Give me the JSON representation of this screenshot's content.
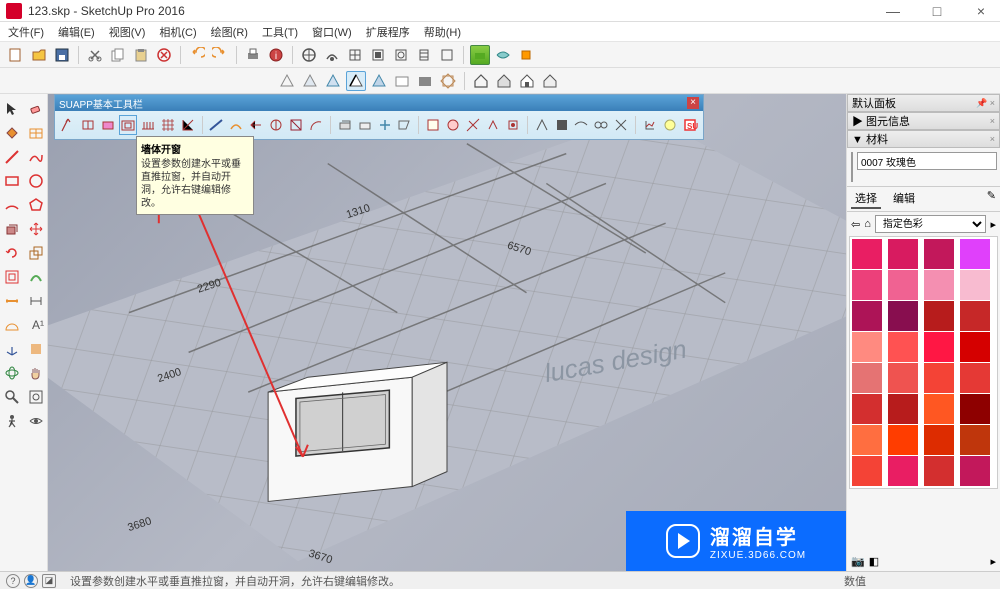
{
  "window": {
    "title": "123.skp - SketchUp Pro 2016",
    "min": "—",
    "max": "□",
    "close": "×"
  },
  "menu": {
    "file": "文件(F)",
    "edit": "编辑(E)",
    "view": "视图(V)",
    "camera": "相机(C)",
    "draw": "绘图(R)",
    "tools": "工具(T)",
    "window": "窗口(W)",
    "extensions": "扩展程序",
    "help": "帮助(H)"
  },
  "suapp": {
    "title": "SUAPP基本工具栏",
    "close": "×"
  },
  "tooltip": {
    "title": "墙体开窗",
    "body": "设置参数创建水平或垂直推拉窗，并自动开洞，允许右键编辑修改。"
  },
  "panel": {
    "default_panel": "默认面板",
    "entity_info": "▶  图元信息",
    "materials": "▼  材料",
    "material_name": "0007 玫瑰色",
    "tabs": {
      "select": "选择",
      "edit": "编辑"
    },
    "dropdown_value": "指定色彩"
  },
  "statusbar": {
    "hint": "设置参数创建水平或垂直推拉窗，并自动开洞，允许右键编辑修改。",
    "value_label": "数值"
  },
  "watermark": {
    "main": "溜溜自学",
    "sub": "ZIXUE.3D66.COM"
  },
  "swatches": [
    "#e91e63",
    "#d81b60",
    "#c2185b",
    "#e040fb",
    "#ec407a",
    "#f06292",
    "#f48fb1",
    "#f8bbd0",
    "#ad1457",
    "#880e4f",
    "#b71c1c",
    "#c62828",
    "#ff8a80",
    "#ff5252",
    "#ff1744",
    "#d50000",
    "#e57373",
    "#ef5350",
    "#f44336",
    "#e53935",
    "#d32f2f",
    "#b71c1c",
    "#ff5722",
    "#8e0000",
    "#ff6e40",
    "#ff3d00",
    "#dd2c00",
    "#bf360c",
    "#f44336",
    "#e91e63",
    "#d32f2f",
    "#c2185b"
  ],
  "viewport_labels": {
    "d1": "3680",
    "d2": "2400",
    "d3": "2290",
    "d4": "1310",
    "d5": "6570",
    "d6": "3670",
    "wm": "lucas design"
  }
}
